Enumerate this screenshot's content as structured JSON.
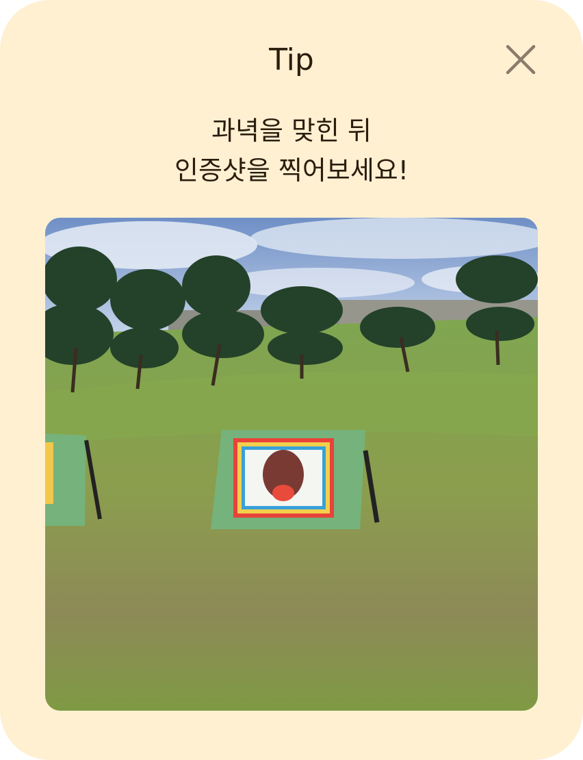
{
  "dialog": {
    "title": "Tip",
    "close_icon": "close-icon",
    "message_line1": "과녁을 맞힌 뒤",
    "message_line2": "인증샷을 찍어보세요!"
  },
  "colors": {
    "background": "#fff0d2",
    "text": "#2a1d0e",
    "close_icon": "#8a7c6a"
  }
}
